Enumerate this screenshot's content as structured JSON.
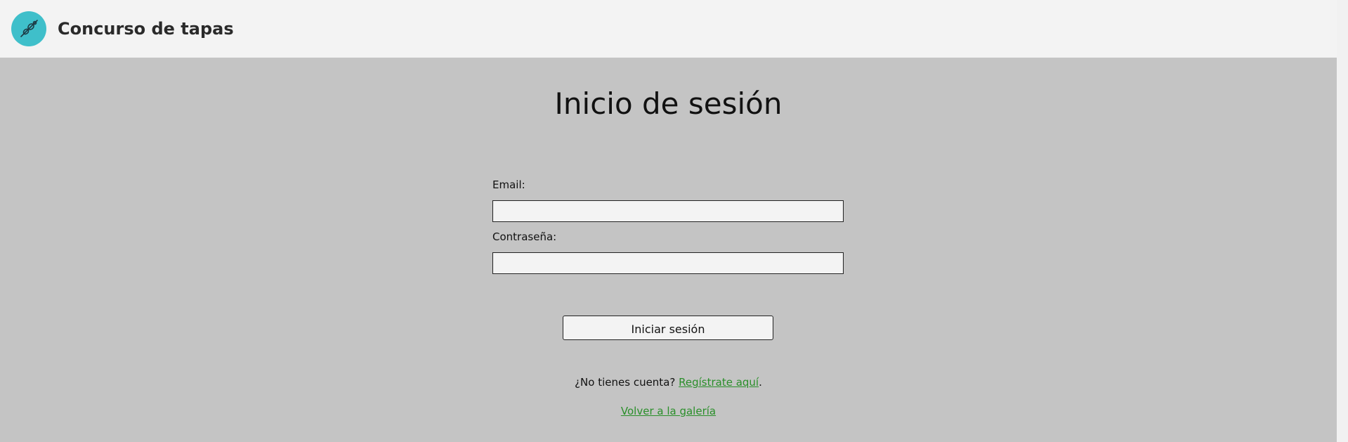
{
  "header": {
    "site_title": "Concurso de tapas",
    "logo_icon": "skewer-icon",
    "logo_color": "#3fbfca"
  },
  "main": {
    "heading": "Inicio de sesión",
    "form": {
      "email_label": "Email:",
      "email_value": "",
      "password_label": "Contraseña:",
      "password_value": "",
      "submit_label": "Iniciar sesión"
    },
    "register": {
      "prompt": "¿No tienes cuenta? ",
      "link_label": "Regístrate aquí",
      "suffix": "."
    },
    "gallery_link_label": "Volver a la galería"
  },
  "colors": {
    "background": "#c4c4c4",
    "header_background": "#f3f3f3",
    "link": "#2a8f2a"
  }
}
